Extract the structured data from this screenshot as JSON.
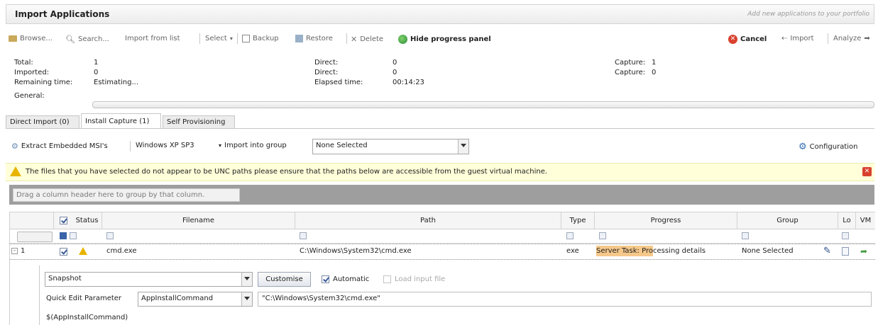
{
  "window": {
    "title": "Import Applications",
    "subtitle": "Add new applications to your portfolio"
  },
  "toolbar": {
    "browse": "Browse...",
    "search": "Search...",
    "import_from_list": "Import from list",
    "select": "Select",
    "backup": "Backup",
    "restore": "Restore",
    "delete": "Delete",
    "hide_progress": "Hide progress panel",
    "cancel": "Cancel",
    "import": "Import",
    "analyze": "Analyze"
  },
  "stats": {
    "total_label": "Total:",
    "total_value": "1",
    "imported_label": "Imported:",
    "imported_value": "0",
    "remaining_label": "Remaining time:",
    "remaining_value": "Estimating...",
    "general_label": "General:",
    "direct1_label": "Direct:",
    "direct1_value": "0",
    "direct2_label": "Direct:",
    "direct2_value": "0",
    "elapsed_label": "Elapsed time:",
    "elapsed_value": "00:14:23",
    "capture1_label": "Capture:",
    "capture1_value": "1",
    "capture2_label": "Capture:",
    "capture2_value": "0",
    "general_progress": 0
  },
  "tabs": [
    "Direct Import (0)",
    "Install Capture (1)",
    "Self Provisioning"
  ],
  "subbar": {
    "extract": "Extract Embedded MSI's",
    "os": "Windows XP SP3",
    "import_group_label": "Import into group",
    "group_value": "None Selected",
    "configuration": "Configuration"
  },
  "warning": {
    "text": "The files that you have selected do not appear to be UNC paths please ensure that the paths below are accessible from the guest virtual machine."
  },
  "grid": {
    "group_hint": "Drag a column header here to group by that column.",
    "columns": [
      "Status",
      "Filename",
      "Path",
      "Type",
      "Progress",
      "Group",
      "Lo",
      "VM"
    ],
    "row": {
      "number": "1",
      "filename": "cmd.exe",
      "path": "C:\\Windows\\System32\\cmd.exe",
      "type": "exe",
      "progress_highlight": "Server Task: Pro",
      "progress_rest": "cessing details",
      "group": "None Selected"
    }
  },
  "detail": {
    "snapshot_value": "Snapshot",
    "customise": "Customise",
    "automatic": "Automatic",
    "load_input": "Load input file",
    "qep_label": "Quick Edit Parameter",
    "qep_value": "AppInstallCommand",
    "qep_text": "\"C:\\Windows\\System32\\cmd.exe\"",
    "variable": "$(AppInstallCommand)"
  },
  "colors": {
    "warning_bg": "#ffffd9",
    "progress_highlight": "#f5c88a",
    "group_area": "#9e9e9e",
    "cancel_red": "#d9412e"
  }
}
